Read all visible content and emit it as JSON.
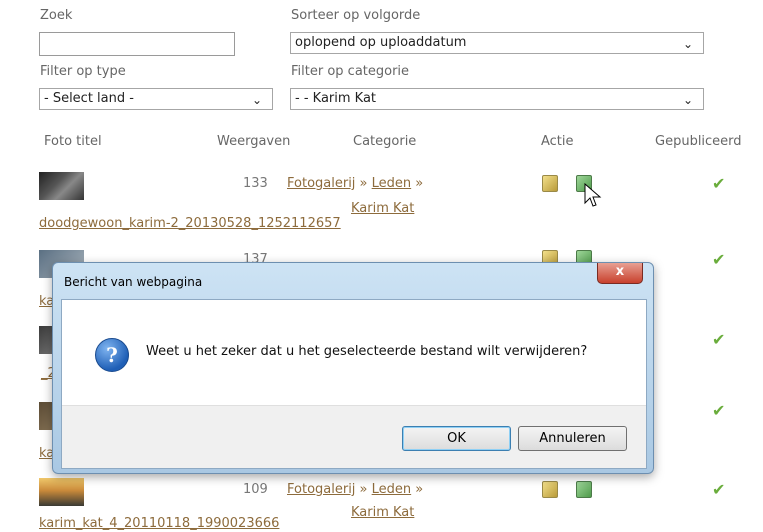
{
  "filters": {
    "search_label": "Zoek",
    "search_value": "",
    "sort_label": "Sorteer op volgorde",
    "sort_value": "oplopend op uploaddatum",
    "type_label": "Filter op type",
    "type_value": "- Select land -",
    "category_label": "Filter op categorie",
    "category_value": "- - Karim Kat"
  },
  "table": {
    "headers": [
      "Foto titel",
      "Weergaven",
      "Categorie",
      "Actie",
      "Gepubliceerd"
    ],
    "rows": [
      {
        "views": "133",
        "cat1": "Fotogalerij",
        "sep1": " » ",
        "cat2": "Leden",
        "sep2": " »",
        "cat3": "Karim Kat",
        "filename": "doodgewoon_karim-2_20130528_1252112657"
      },
      {
        "views": "137",
        "filename_partial": "ka"
      },
      {
        "filename_partial": "_2"
      },
      {
        "filename_partial": "ka"
      },
      {
        "views": "109",
        "cat1": "Fotogalerij",
        "sep1": " » ",
        "cat2": "Leden",
        "sep2": " »",
        "cat3": "Karim Kat",
        "filename": "karim_kat_4_20110118_1990023666"
      }
    ],
    "published_icon": "check-icon"
  },
  "dialog": {
    "title": "Bericht van webpagina",
    "close_label": "x",
    "question_icon": "?",
    "message": "Weet u het zeker dat u het geselecteerde bestand wilt verwijderen?",
    "ok_label": "OK",
    "cancel_label": "Annuleren"
  },
  "colors": {
    "link": "#8d6b3c",
    "check": "#6aad3c",
    "dialog_frame": "#a9c8e3"
  }
}
